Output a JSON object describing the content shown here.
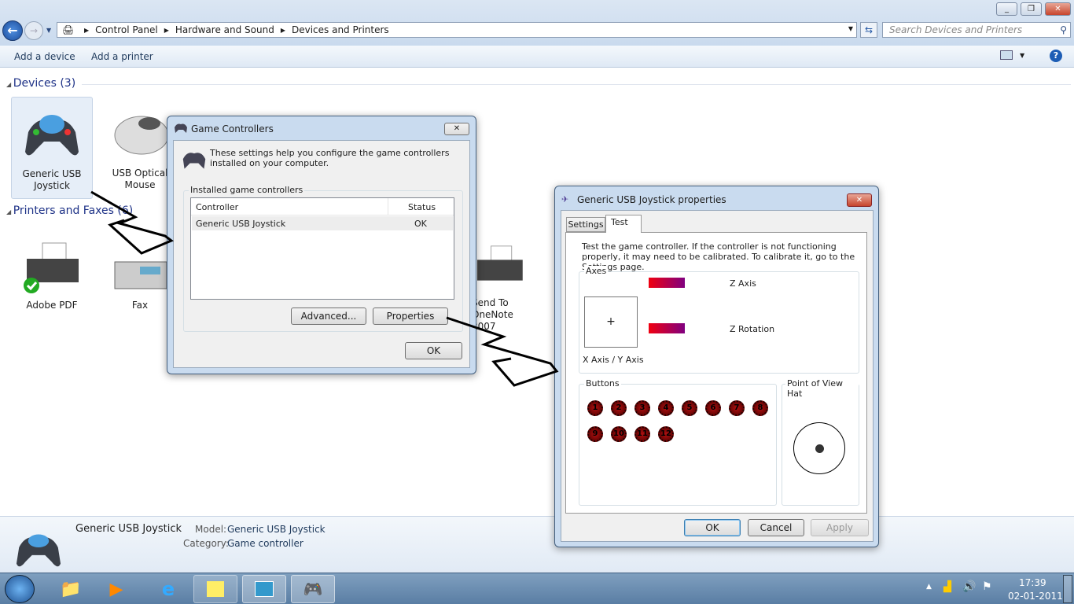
{
  "window": {
    "minimize": "_",
    "maximize": "❐",
    "close": "✕"
  },
  "address": {
    "crumbs": [
      "Control Panel",
      "Hardware and Sound",
      "Devices and Printers"
    ],
    "search_placeholder": "Search Devices and Printers"
  },
  "toolbar": {
    "add_device": "Add a device",
    "add_printer": "Add a printer",
    "help": "?"
  },
  "groups": {
    "devices": "Devices (3)",
    "printers": "Printers and Faxes (6)"
  },
  "devices": [
    {
      "label": "Generic  USB Joystick"
    },
    {
      "label": "USB Optical Mouse"
    }
  ],
  "printers": [
    {
      "label": "Adobe PDF"
    },
    {
      "label": "Fax"
    },
    {
      "label": "Send To OneNote 2007"
    }
  ],
  "details": {
    "name": "Generic   USB  Joystick",
    "model_label": "Model:",
    "model": "Generic   USB  Joystick",
    "category_label": "Category:",
    "category": "Game controller"
  },
  "clock": {
    "time": "17:39",
    "date": "02-01-2011"
  },
  "game_controllers": {
    "title": "Game Controllers",
    "close": "✕",
    "intro": "These settings help you configure the game controllers installed on your computer.",
    "group_label": "Installed game controllers",
    "col_controller": "Controller",
    "col_status": "Status",
    "rows": [
      {
        "controller": "Generic   USB  Joystick",
        "status": "OK"
      }
    ],
    "advanced": "Advanced...",
    "properties": "Properties",
    "ok": "OK"
  },
  "properties": {
    "title": "Generic   USB  Joystick   properties",
    "close": "✕",
    "tabs": [
      "Settings",
      "Test"
    ],
    "intro": "Test the game controller.  If the controller is not functioning properly, it may need to be calibrated.  To calibrate it, go to the Settings page.",
    "axes_label": "Axes",
    "xy_label": "X Axis / Y Axis",
    "z_axis": "Z Axis",
    "z_rotation": "Z Rotation",
    "buttons_label": "Buttons",
    "buttons": [
      "1",
      "2",
      "3",
      "4",
      "5",
      "6",
      "7",
      "8",
      "9",
      "10",
      "11",
      "12"
    ],
    "pov_label": "Point of View Hat",
    "ok": "OK",
    "cancel": "Cancel",
    "apply": "Apply"
  }
}
